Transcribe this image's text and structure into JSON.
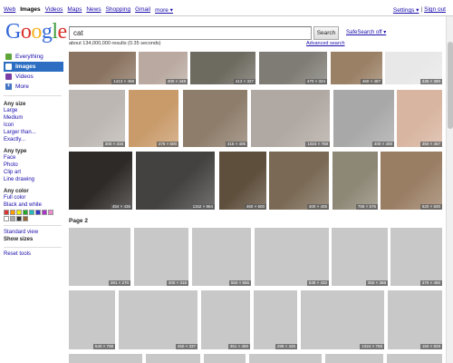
{
  "topnav": {
    "items": [
      "Web",
      "Images",
      "Videos",
      "Maps",
      "News",
      "Shopping",
      "Gmail",
      "more ▾"
    ]
  },
  "toplinks": {
    "settings": "Settings ▾",
    "sep": "|",
    "signout": "Sign out"
  },
  "logo": {
    "letters": [
      "G",
      "o",
      "o",
      "g",
      "l",
      "e"
    ],
    "colors": [
      "#3467d8",
      "#d9302a",
      "#f6b21d",
      "#3467d8",
      "#3d9a3d",
      "#d9302a"
    ]
  },
  "search": {
    "query": "cat",
    "button": "Search",
    "safesearch": "SafeSearch off ▾",
    "results": "about 134,000,000 results (0.35 seconds)",
    "advanced": "Advanced search"
  },
  "sidebar": {
    "nav": [
      {
        "label": "Everything",
        "icon": "everything-icon",
        "color": "#5fa53a"
      },
      {
        "label": "Images",
        "icon": "images-icon",
        "color": "#ffffff"
      },
      {
        "label": "Videos",
        "icon": "videos-icon",
        "color": "#7a3fa6"
      },
      {
        "label": "More",
        "icon": "more-icon",
        "color": "#4474c4"
      }
    ],
    "size_head": "Any size",
    "sizes": [
      "Large",
      "Medium",
      "Icon",
      "Larger than...",
      "Exactly..."
    ],
    "type_head": "Any type",
    "types": [
      "Face",
      "Photo",
      "Clip art",
      "Line drawing"
    ],
    "color_head": "Any color",
    "colors": [
      "Full color",
      "Black and white"
    ],
    "swatches": [
      "#d33",
      "#f90",
      "#ee0",
      "#2a2",
      "#2bb",
      "#33c",
      "#a3c",
      "#e8c",
      "#fff",
      "#aaa",
      "#333",
      "#963"
    ],
    "view": [
      "Standard view"
    ],
    "show_sizes": "Show sizes",
    "reset": "Reset tools"
  },
  "page2": "Page 2",
  "images": [
    {
      "caption": "1413 × 458",
      "fill": "#8a7360"
    },
    {
      "caption": "400 × 448",
      "fill": "#b9a9a0"
    },
    {
      "caption": "413 × 327",
      "fill": "#6d6a60"
    },
    {
      "caption": "470 × 324",
      "fill": "#7f7c75"
    },
    {
      "caption": "460 × 487",
      "fill": "#9a8065"
    },
    {
      "caption": "436 × 390",
      "fill": "#e8e8e8"
    },
    {
      "caption": "300 × 316",
      "fill": "#bcb7b2"
    },
    {
      "caption": "476 × 600",
      "fill": "#c99b6b"
    },
    {
      "caption": "415 × 405",
      "fill": "#8e7d6b"
    },
    {
      "caption": "1024 × 768",
      "fill": "#b0a8a2"
    },
    {
      "caption": "400 × 400",
      "fill": "#a8a8a8"
    },
    {
      "caption": "350 × 467",
      "fill": "#d8b5a0"
    },
    {
      "caption": "454 × 435",
      "fill": "#2e2a28"
    },
    {
      "caption": "1152 × 864",
      "fill": "#444240"
    },
    {
      "caption": "460 × 600",
      "fill": "#5e4e3c"
    },
    {
      "caption": "400 × 405",
      "fill": "#7a6a55"
    },
    {
      "caption": "768 × 576",
      "fill": "#8d8775"
    },
    {
      "caption": "620 × 600",
      "fill": "#9a7e64"
    },
    {
      "caption": "281 × 270",
      "fill": "#c8c8c8"
    },
    {
      "caption": "300 × 318",
      "fill": "#c8c8c8"
    },
    {
      "caption": "550 × 555",
      "fill": "#c8c8c8"
    },
    {
      "caption": "538 × 432",
      "fill": "#c8c8c8"
    },
    {
      "caption": "350 × 368",
      "fill": "#c8c8c8"
    },
    {
      "caption": "375 × 450",
      "fill": "#c8c8c8"
    },
    {
      "caption": "540 × 708",
      "fill": "#c8c8c8"
    },
    {
      "caption": "450 × 337",
      "fill": "#c8c8c8"
    },
    {
      "caption": "361 × 450",
      "fill": "#c8c8c8"
    },
    {
      "caption": "298 × 425",
      "fill": "#c8c8c8"
    },
    {
      "caption": "1024 × 768",
      "fill": "#c8c8c8"
    },
    {
      "caption": "150 × 829",
      "fill": "#c8c8c8"
    },
    {
      "caption": "",
      "fill": "#c8c8c8"
    },
    {
      "caption": "",
      "fill": "#c8c8c8"
    },
    {
      "caption": "",
      "fill": "#c8c8c8"
    },
    {
      "caption": "",
      "fill": "#c8c8c8"
    },
    {
      "caption": "",
      "fill": "#c8c8c8"
    },
    {
      "caption": "",
      "fill": "#c8c8c8"
    }
  ]
}
